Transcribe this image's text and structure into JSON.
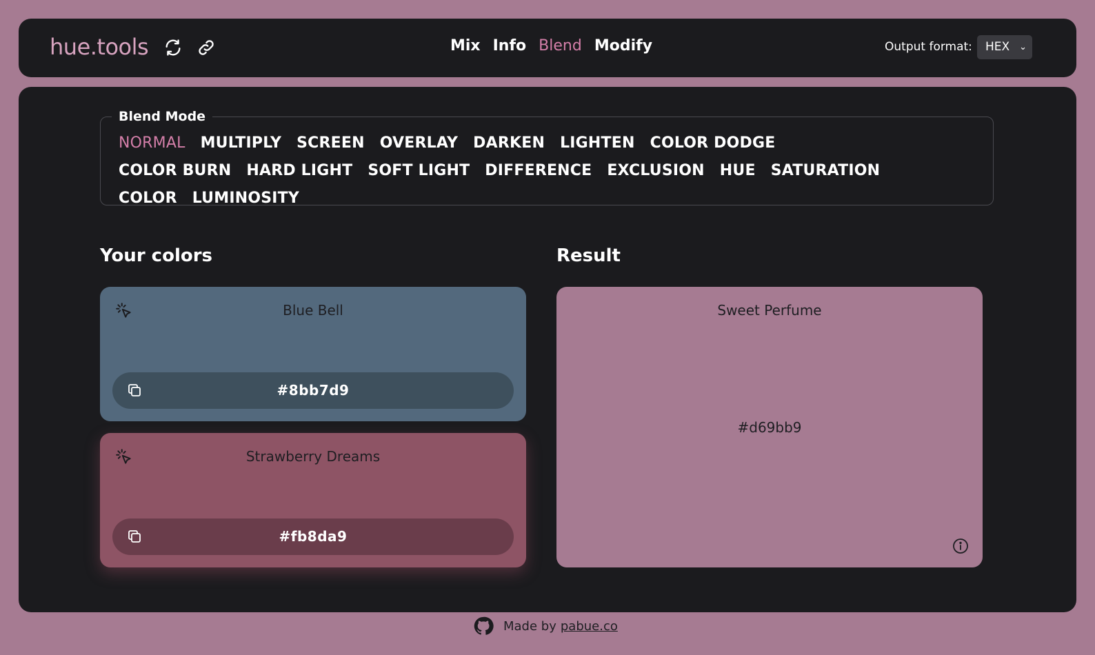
{
  "header": {
    "logo": "hue.tools",
    "icons": [
      "refresh-icon",
      "link-icon"
    ],
    "nav": [
      {
        "label": "Mix",
        "active": false
      },
      {
        "label": "Info",
        "active": false
      },
      {
        "label": "Blend",
        "active": true
      },
      {
        "label": "Modify",
        "active": false
      }
    ],
    "output_format_label": "Output format:",
    "output_format_value": "HEX"
  },
  "blend": {
    "legend": "Blend Mode",
    "modes": [
      "NORMAL",
      "MULTIPLY",
      "SCREEN",
      "OVERLAY",
      "DARKEN",
      "LIGHTEN",
      "COLOR DODGE",
      "COLOR BURN",
      "HARD LIGHT",
      "SOFT LIGHT",
      "DIFFERENCE",
      "EXCLUSION",
      "HUE",
      "SATURATION",
      "COLOR",
      "LUMINOSITY"
    ],
    "active_mode": "NORMAL"
  },
  "your_colors": {
    "title": "Your colors",
    "colors": [
      {
        "name": "Blue Bell",
        "hex": "#8bb7d9",
        "card_color": "#53697d"
      },
      {
        "name": "Strawberry Dreams",
        "hex": "#fb8da9",
        "card_color": "#8e5465"
      }
    ]
  },
  "result": {
    "title": "Result",
    "name": "Sweet Perfume",
    "hex": "#d69bb9"
  },
  "footer": {
    "made_by": "Made by",
    "link": "pabue.co"
  },
  "colors": {
    "background": "#a67b92",
    "panel": "#1b1b1e",
    "accent": "#d47fa9"
  }
}
